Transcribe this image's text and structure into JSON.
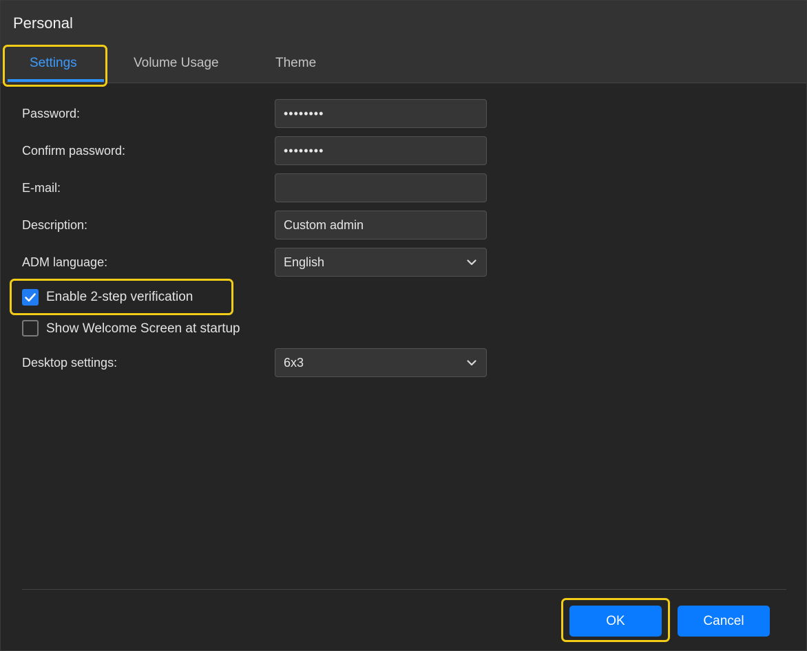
{
  "dialog": {
    "title": "Personal"
  },
  "tabs": [
    {
      "label": "Settings",
      "active": true
    },
    {
      "label": "Volume Usage",
      "active": false
    },
    {
      "label": "Theme",
      "active": false
    }
  ],
  "form": {
    "password": {
      "label": "Password:",
      "value": "••••••••"
    },
    "confirm_password": {
      "label": "Confirm password:",
      "value": "••••••••"
    },
    "email": {
      "label": "E-mail:",
      "value": ""
    },
    "description": {
      "label": "Description:",
      "value": "Custom admin"
    },
    "adm_language": {
      "label": "ADM language:",
      "value": "English",
      "icon": "chevron-down-icon"
    },
    "two_step": {
      "label": "Enable 2-step verification",
      "checked": true,
      "icon": "checkmark-icon"
    },
    "welcome_screen": {
      "label": "Show Welcome Screen at startup",
      "checked": false
    },
    "desktop_settings": {
      "label": "Desktop settings:",
      "value": "6x3",
      "icon": "chevron-down-icon"
    }
  },
  "footer": {
    "ok_label": "OK",
    "cancel_label": "Cancel"
  },
  "colors": {
    "accent": "#0a7aff",
    "active_tab": "#3d9cff",
    "highlight": "#f3cc17",
    "background": "#252525",
    "header": "#333333"
  }
}
